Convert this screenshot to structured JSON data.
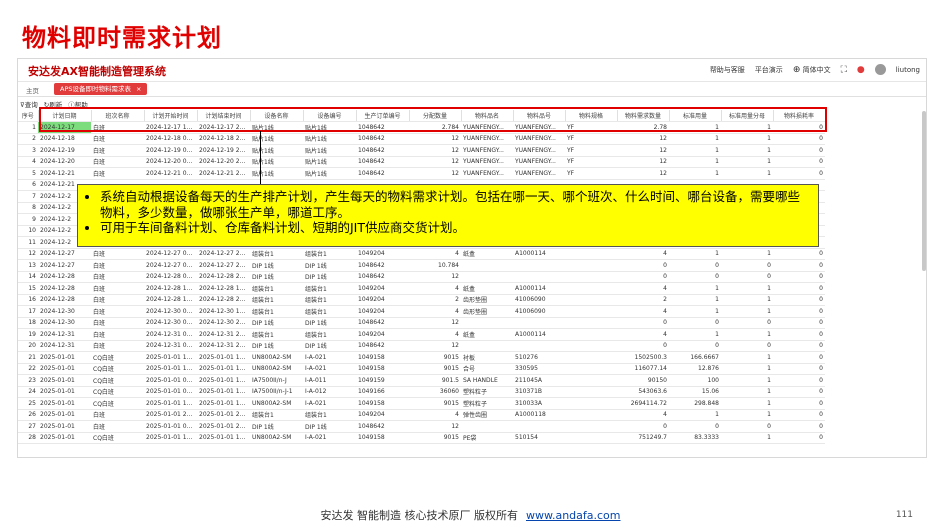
{
  "slide": {
    "title": "物料即时需求计划",
    "footer_text": "安达发  智能制造 核心技术原厂   版权所有",
    "footer_link": "www.andafa.com",
    "page_number": "111"
  },
  "app": {
    "brand": "安达发AX智能制造管理系统",
    "help": "帮助与客服",
    "platform": "平台演示",
    "language": "简体中文",
    "user": "liutong"
  },
  "tabs": {
    "home": "主页",
    "active": "APS设备即时物料需求表",
    "close": "×"
  },
  "toolbar": {
    "query": "查询",
    "refresh": "刷新",
    "help": "帮助"
  },
  "table": {
    "columns": [
      "序号",
      "计划日期",
      "班次名称",
      "计划开始时间",
      "计划结束时间",
      "设备名称",
      "设备编号",
      "生产订单编号",
      "分配数量",
      "物料品名",
      "物料品号",
      "物料规格",
      "物料需求数量",
      "标准用量",
      "标准用量分母",
      "物料损耗率"
    ],
    "rows": [
      [
        "1",
        "2024-12-17",
        "白班",
        "2024-12-17 1...",
        "2024-12-17 2...",
        "贴片1线",
        "贴片1线",
        "1048642",
        "2.784",
        "YUANFENGY...",
        "YUANFENGY...",
        "YF",
        "2.78",
        "1",
        "1",
        "0"
      ],
      [
        "2",
        "2024-12-18",
        "白班",
        "2024-12-18 0...",
        "2024-12-18 2...",
        "贴片1线",
        "贴片1线",
        "1048642",
        "12",
        "YUANFENGY...",
        "YUANFENGY...",
        "YF",
        "12",
        "1",
        "1",
        "0"
      ],
      [
        "3",
        "2024-12-19",
        "白班",
        "2024-12-19 0...",
        "2024-12-19 2...",
        "贴片1线",
        "贴片1线",
        "1048642",
        "12",
        "YUANFENGY...",
        "YUANFENGY...",
        "YF",
        "12",
        "1",
        "1",
        "0"
      ],
      [
        "4",
        "2024-12-20",
        "白班",
        "2024-12-20 0...",
        "2024-12-20 2...",
        "贴片1线",
        "贴片1线",
        "1048642",
        "12",
        "YUANFENGY...",
        "YUANFENGY...",
        "YF",
        "12",
        "1",
        "1",
        "0"
      ],
      [
        "5",
        "2024-12-21",
        "白班",
        "2024-12-21 0...",
        "2024-12-21 2...",
        "贴片1线",
        "贴片1线",
        "1048642",
        "12",
        "YUANFENGY...",
        "YUANFENGY...",
        "YF",
        "12",
        "1",
        "1",
        "0"
      ],
      [
        "6",
        "2024-12-21",
        "",
        "",
        "",
        "",
        "",
        "",
        "",
        "",
        "",
        "",
        "",
        "",
        "",
        ""
      ],
      [
        "7",
        "2024-12-2",
        "",
        "",
        "",
        "",
        "",
        "",
        "",
        "",
        "",
        "",
        "",
        "",
        "",
        ""
      ],
      [
        "8",
        "2024-12-2",
        "",
        "",
        "",
        "",
        "",
        "",
        "",
        "",
        "",
        "",
        "",
        "",
        "",
        ""
      ],
      [
        "9",
        "2024-12-2",
        "",
        "",
        "",
        "",
        "",
        "",
        "",
        "",
        "",
        "",
        "",
        "",
        "",
        ""
      ],
      [
        "10",
        "2024-12-2",
        "",
        "",
        "",
        "",
        "",
        "",
        "",
        "",
        "",
        "",
        "",
        "",
        "",
        ""
      ],
      [
        "11",
        "2024-12-2",
        "",
        "",
        "",
        "",
        "",
        "",
        "",
        "",
        "",
        "",
        "",
        "",
        "",
        ""
      ],
      [
        "12",
        "2024-12-27",
        "白班",
        "2024-12-27 0...",
        "2024-12-27 2...",
        "组装台1",
        "组装台1",
        "1049204",
        "4",
        "纸盒",
        "A1000114",
        "",
        "4",
        "1",
        "1",
        "0"
      ],
      [
        "13",
        "2024-12-27",
        "白班",
        "2024-12-27 0...",
        "2024-12-27 2...",
        "DIP 1线",
        "DIP 1线",
        "1048642",
        "10.784",
        "",
        "",
        "",
        "0",
        "0",
        "0",
        "0"
      ],
      [
        "14",
        "2024-12-28",
        "白班",
        "2024-12-28 0...",
        "2024-12-28 2...",
        "DIP 1线",
        "DIP 1线",
        "1048642",
        "12",
        "",
        "",
        "",
        "0",
        "0",
        "0",
        "0"
      ],
      [
        "15",
        "2024-12-28",
        "白班",
        "2024-12-28 1...",
        "2024-12-28 1...",
        "组装台1",
        "组装台1",
        "1049204",
        "4",
        "纸盒",
        "A1000114",
        "",
        "4",
        "1",
        "1",
        "0"
      ],
      [
        "16",
        "2024-12-28",
        "白班",
        "2024-12-28 1...",
        "2024-12-28 2...",
        "组装台1",
        "组装台1",
        "1049204",
        "2",
        "齿形垫圈",
        "41006090",
        "",
        "2",
        "1",
        "1",
        "0"
      ],
      [
        "17",
        "2024-12-30",
        "白班",
        "2024-12-30 0...",
        "2024-12-30 1...",
        "组装台1",
        "组装台1",
        "1049204",
        "4",
        "齿形垫圈",
        "41006090",
        "",
        "4",
        "1",
        "1",
        "0"
      ],
      [
        "18",
        "2024-12-30",
        "白班",
        "2024-12-30 0...",
        "2024-12-30 2...",
        "DIP 1线",
        "DIP 1线",
        "1048642",
        "12",
        "",
        "",
        "",
        "0",
        "0",
        "0",
        "0"
      ],
      [
        "19",
        "2024-12-31",
        "白班",
        "2024-12-31 0...",
        "2024-12-31 2...",
        "组装台1",
        "组装台1",
        "1049204",
        "4",
        "纸盒",
        "A1000114",
        "",
        "4",
        "1",
        "1",
        "0"
      ],
      [
        "20",
        "2024-12-31",
        "白班",
        "2024-12-31 0...",
        "2024-12-31 2...",
        "DIP 1线",
        "DIP 1线",
        "1048642",
        "12",
        "",
        "",
        "",
        "0",
        "0",
        "0",
        "0"
      ],
      [
        "21",
        "2025-01-01",
        "CQ白班",
        "2025-01-01 1...",
        "2025-01-01 1...",
        "UN800A2-SM",
        "I-A-021",
        "1049158",
        "9015",
        "衬板",
        "510276",
        "",
        "1502500.3",
        "166.6667",
        "1",
        "0"
      ],
      [
        "22",
        "2025-01-01",
        "CQ白班",
        "2025-01-01 1...",
        "2025-01-01 1...",
        "UN800A2-SM",
        "I-A-021",
        "1049158",
        "9015",
        "合号",
        "330595",
        "",
        "116077.14",
        "12.876",
        "1",
        "0"
      ],
      [
        "23",
        "2025-01-01",
        "CQ白班",
        "2025-01-01 0...",
        "2025-01-01 1...",
        "IA7500II/n-J",
        "I-A-011",
        "1049159",
        "901.5",
        "SA HANDLE",
        "211045A",
        "",
        "90150",
        "100",
        "1",
        "0"
      ],
      [
        "24",
        "2025-01-01",
        "CQ白班",
        "2025-01-01 0...",
        "2025-01-01 1...",
        "IA7500II/n-J-1",
        "I-A-012",
        "1049166",
        "36060",
        "塑料粒子",
        "310371B",
        "",
        "543063.6",
        "15.06",
        "1",
        "0"
      ],
      [
        "25",
        "2025-01-01",
        "CQ白班",
        "2025-01-01 1...",
        "2025-01-01 1...",
        "UN800A2-SM",
        "I-A-021",
        "1049158",
        "9015",
        "塑料粒子",
        "310033A",
        "",
        "2694114.72",
        "298.848",
        "1",
        "0"
      ],
      [
        "26",
        "2025-01-01",
        "白班",
        "2025-01-01 2...",
        "2025-01-01 2...",
        "组装台1",
        "组装台1",
        "1049204",
        "4",
        "弹性齿圈",
        "A1000118",
        "",
        "4",
        "1",
        "1",
        "0"
      ],
      [
        "27",
        "2025-01-01",
        "白班",
        "2025-01-01 0...",
        "2025-01-01 2...",
        "DIP 1线",
        "DIP 1线",
        "1048642",
        "12",
        "",
        "",
        "",
        "0",
        "0",
        "0",
        "0"
      ],
      [
        "28",
        "2025-01-01",
        "CQ白班",
        "2025-01-01 1...",
        "2025-01-01 1...",
        "UN800A2-SM",
        "I-A-021",
        "1049158",
        "9015",
        "PE袋",
        "510154",
        "",
        "751249.7",
        "83.3333",
        "1",
        "0"
      ]
    ]
  },
  "callout": {
    "line1": "系统自动根据设备每天的生产排产计划，产生每天的物料需求计划。包括在哪一天、哪个班次、什么时间、哪台设备，需要哪些物料，多少数量，做哪张生产单，哪道工序。",
    "line2": "可用于车间备料计划、仓库备料计划、短期的JIT供应商交货计划。"
  }
}
